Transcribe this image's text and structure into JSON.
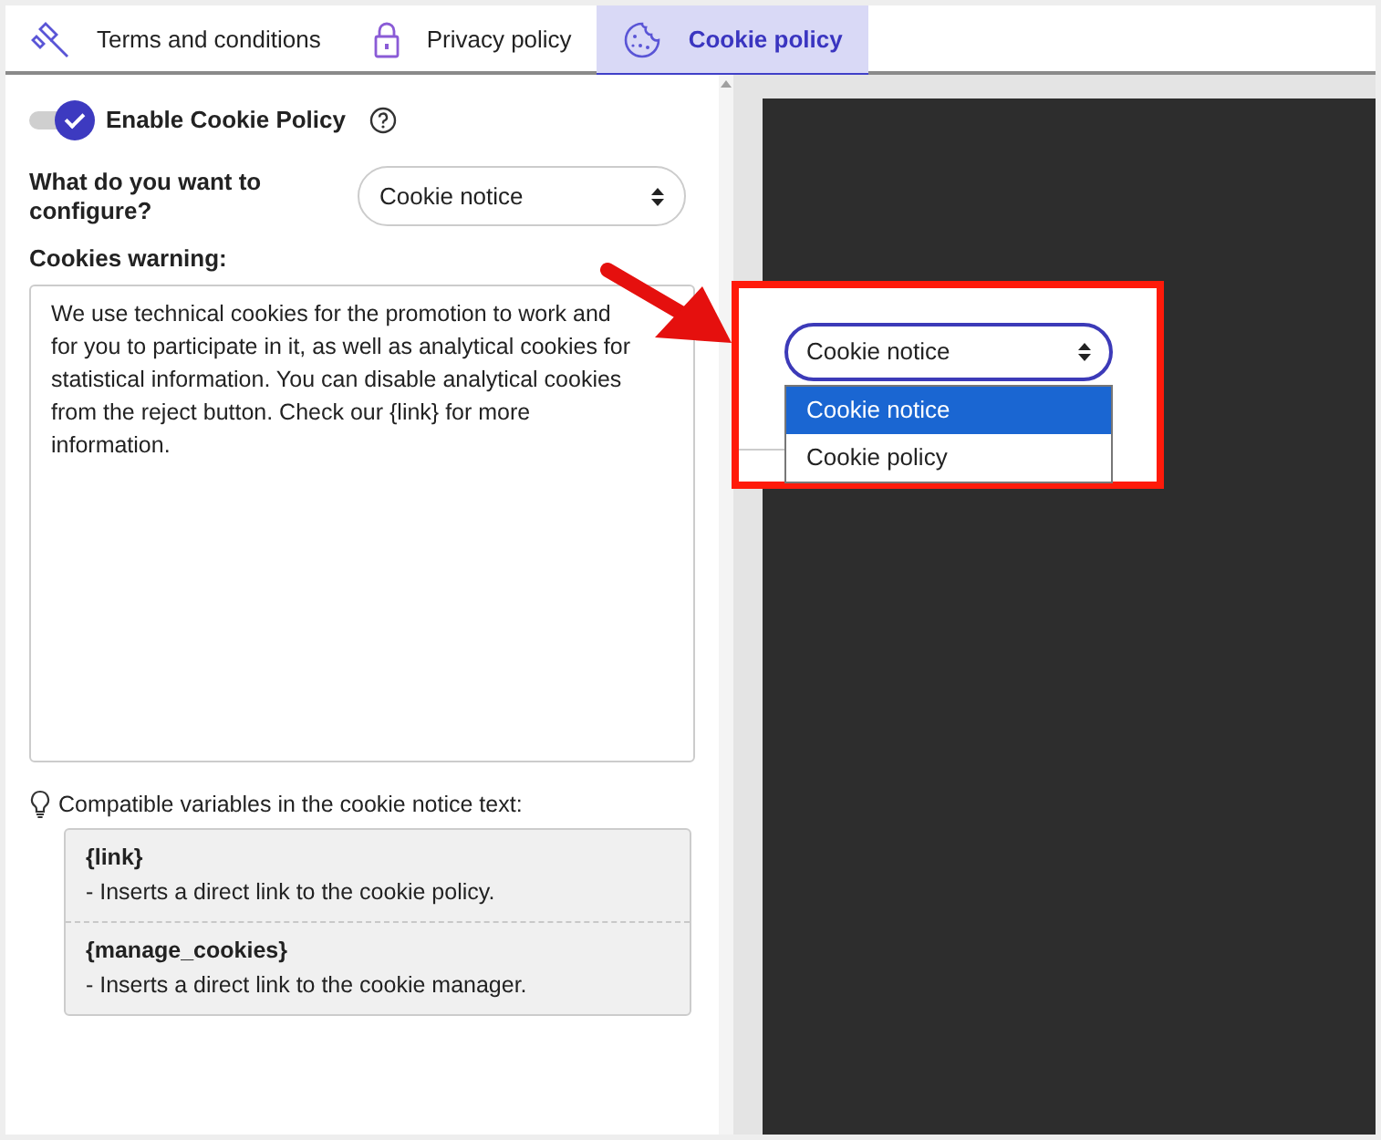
{
  "tabs": [
    {
      "label": "Terms and conditions",
      "selected": false
    },
    {
      "label": "Privacy policy",
      "selected": false
    },
    {
      "label": "Cookie policy",
      "selected": true
    }
  ],
  "enable_toggle": {
    "label": "Enable Cookie Policy",
    "on": true
  },
  "configure": {
    "label": "What do you want to configure?",
    "value": "Cookie notice"
  },
  "cookies_warning": {
    "label": "Cookies warning:",
    "text": "We use technical cookies for the promotion to work and for you to participate in it, as well as analytical cookies for statistical information. You can disable analytical cookies from the reject button. Check our {link} for more information."
  },
  "variables_hint": "Compatible variables in the cookie notice text:",
  "variables": [
    {
      "name": "{link}",
      "description": "- Inserts a direct link to the cookie policy."
    },
    {
      "name": "{manage_cookies}",
      "description": "- Inserts a direct link to the cookie manager."
    }
  ],
  "preview_dropdown": {
    "value": "Cookie notice",
    "options": [
      {
        "label": "Cookie notice",
        "selected": true
      },
      {
        "label": "Cookie policy",
        "selected": false
      }
    ]
  }
}
